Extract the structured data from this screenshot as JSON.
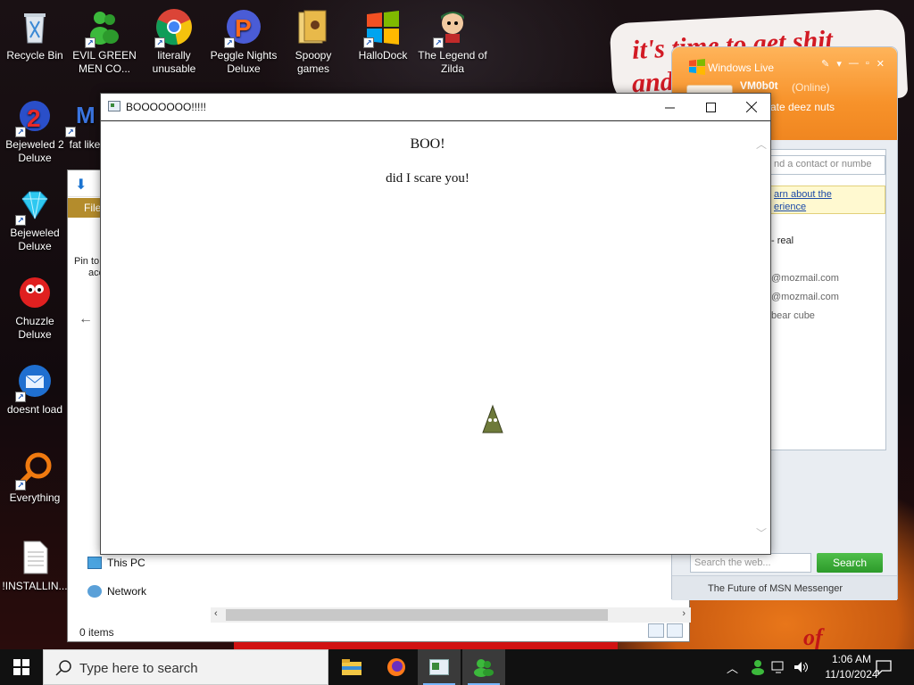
{
  "desktop": {
    "wallpaper_text_1": "it's time to get shit",
    "wallpaper_text_2": "and",
    "wallpaper_mark": "of",
    "icons": [
      {
        "label": "Recycle Bin"
      },
      {
        "label": "EVIL GREEN MEN CO..."
      },
      {
        "label": "literally unusable"
      },
      {
        "label": "Peggle Nights Deluxe"
      },
      {
        "label": "Spoopy games"
      },
      {
        "label": "HalloDock"
      },
      {
        "label": "The Legend of Zilda"
      },
      {
        "label": "Bejeweled 2 Deluxe"
      },
      {
        "label": "fat like"
      },
      {
        "label": "Bejeweled Deluxe"
      },
      {
        "label": "Chuzzle Deluxe"
      },
      {
        "label": "doesnt load"
      },
      {
        "label": "Everything"
      },
      {
        "label": "!INSTALLIN..."
      }
    ]
  },
  "explorer": {
    "ribbon_tab": "File",
    "pin_label_1": "Pin to",
    "pin_label_2": "acc",
    "nav": [
      {
        "label": "This PC"
      },
      {
        "label": "Network"
      }
    ],
    "status": "0 items"
  },
  "messenger": {
    "title": "Windows Live",
    "user": "VM0b0t",
    "status": "(Online)",
    "personal_message": "rate deez nuts",
    "find_placeholder": "nd a contact or numbe",
    "notice_line1": "arn about the",
    "notice_line2": "erience",
    "contacts": [
      {
        "text": "- real"
      },
      {
        "text": "@mozmail.com"
      },
      {
        "text": "@mozmail.com"
      },
      {
        "text": "bear cube"
      }
    ],
    "search_placeholder": "Search the web...",
    "search_button": "Search",
    "footer": "The Future of MSN Messenger"
  },
  "boo_window": {
    "title": "BOOOOOOO!!!!!",
    "heading": "BOO!",
    "body": "did I scare you!"
  },
  "taskbar": {
    "search_placeholder": "Type here to search",
    "time": "1:06 AM",
    "date": "11/10/2024"
  }
}
